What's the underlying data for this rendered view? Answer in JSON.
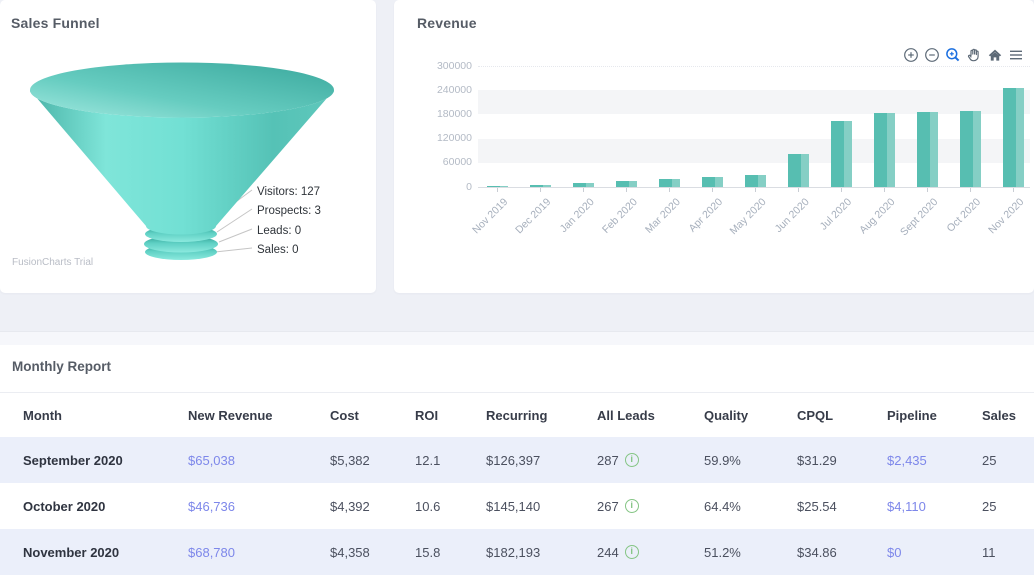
{
  "funnel_card": {
    "title": "Sales Funnel",
    "watermark": "FusionCharts Trial",
    "chart_data": {
      "type": "funnel",
      "stages": [
        {
          "label": "Visitors",
          "value": 127
        },
        {
          "label": "Prospects",
          "value": 3
        },
        {
          "label": "Leads",
          "value": 0
        },
        {
          "label": "Sales",
          "value": 0
        }
      ],
      "display_labels": [
        "Visitors: 127",
        "Prospects: 3",
        "Leads: 0",
        "Sales: 0"
      ],
      "funnel_color": "#5ecfc3"
    }
  },
  "revenue_card": {
    "title": "Revenue",
    "toolbar_icons": [
      "zoom-in",
      "zoom-out",
      "zoom-select",
      "pan",
      "home",
      "menu"
    ],
    "active_tool_color": "#1b6fe0",
    "chart_data": {
      "type": "bar",
      "categories": [
        "Nov 2019",
        "Dec 2019",
        "Jan 2020",
        "Feb 2020",
        "Mar 2020",
        "Apr 2020",
        "May 2020",
        "Jun 2020",
        "Jul 2020",
        "Aug 2020",
        "Sept 2020",
        "Oct 2020",
        "Nov 2020"
      ],
      "values": [
        2000,
        6000,
        9000,
        15000,
        21000,
        24000,
        30000,
        82000,
        163000,
        184000,
        186000,
        188000,
        246000
      ],
      "title": "Revenue",
      "xlabel": "",
      "ylabel": "",
      "ylim": [
        0,
        300000
      ],
      "yticks": [
        0,
        60000,
        120000,
        180000,
        240000,
        300000
      ],
      "grid": "alternating split bands",
      "legend": "none",
      "bar_color_main": "#57beb1",
      "bar_color_light": "#85cfc5"
    }
  },
  "report": {
    "title": "Monthly Report",
    "columns": [
      "Month",
      "New Revenue",
      "Cost",
      "ROI",
      "Recurring",
      "All Leads",
      "Quality",
      "CPQL",
      "Pipeline",
      "Sales"
    ],
    "rows": [
      {
        "month": "September 2020",
        "new_revenue": "$65,038",
        "cost": "$5,382",
        "roi": "12.1",
        "recurring": "$126,397",
        "all_leads": "287",
        "quality": "59.9%",
        "cpql": "$31.29",
        "pipeline": "$2,435",
        "sales": "25"
      },
      {
        "month": "October 2020",
        "new_revenue": "$46,736",
        "cost": "$4,392",
        "roi": "10.6",
        "recurring": "$145,140",
        "all_leads": "267",
        "quality": "64.4%",
        "cpql": "$25.54",
        "pipeline": "$4,110",
        "sales": "25"
      },
      {
        "month": "November 2020",
        "new_revenue": "$68,780",
        "cost": "$4,358",
        "roi": "15.8",
        "recurring": "$182,193",
        "all_leads": "244",
        "quality": "51.2%",
        "cpql": "$34.86",
        "pipeline": "$0",
        "sales": "11"
      }
    ]
  }
}
